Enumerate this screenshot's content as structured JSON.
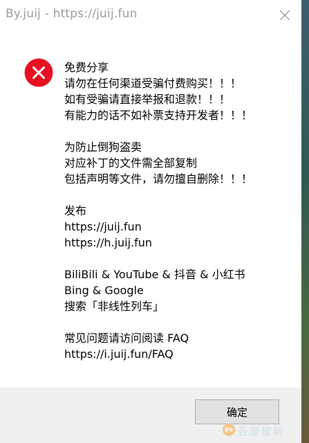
{
  "window": {
    "title": "By.juij - https://juij.fun"
  },
  "icons": {
    "error": "error-x-circle-icon",
    "close": "close-icon"
  },
  "message": {
    "paragraphs": [
      [
        "免费分享",
        "请勿在任何渠道受骗付费购买！！！",
        "如有受骗请直接举报和退款！！！",
        "有能力的话不如补票支持开发者！！！"
      ],
      [
        "为防止倒狗盗卖",
        "对应补丁的文件需全部复制",
        "包括声明等文件，请勿擅自删除！！！"
      ],
      [
        "发布",
        "https://juij.fun",
        "https://h.juij.fun"
      ],
      [
        "BiliBili & YouTube & 抖音 & 小红书",
        "Bing & Google",
        "搜索「非线性列车」"
      ],
      [
        "常见问题请访问阅读 FAQ",
        "https://i.juij.fun/FAQ"
      ]
    ]
  },
  "buttons": {
    "ok_label": "确定"
  },
  "watermark": {
    "badge": "ps",
    "text": "吾爱破解"
  },
  "colors": {
    "error_red": "#e81123",
    "dialog_bg": "#ffffff",
    "footer_bg": "#f0f0f0",
    "title_text": "#9a9a9a"
  }
}
